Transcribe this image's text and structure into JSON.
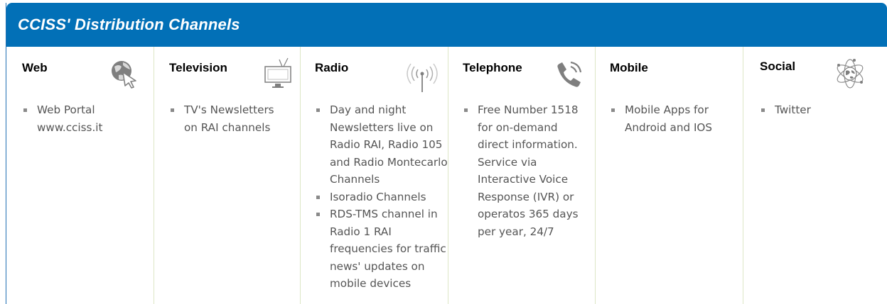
{
  "header": {
    "title": "CCISS' Distribution Channels"
  },
  "colors": {
    "header_bg": "#0270b7",
    "separator": "#dde6c6",
    "text": "#555555"
  },
  "channels": [
    {
      "title": "Web",
      "icon": "globe-cursor-icon",
      "bullets": [
        "Web Portal www.cciss.it"
      ]
    },
    {
      "title": "Television",
      "icon": "tv-icon",
      "bullets": [
        "TV's Newsletters on RAI channels"
      ]
    },
    {
      "title": "Radio",
      "icon": "radio-antenna-icon",
      "bullets": [
        "Day and night Newsletters live on Radio RAI, Radio 105 and Radio Montecarlo Channels",
        "Isoradio Channels",
        "RDS-TMS channel in Radio 1 RAI frequencies for traffic news' updates on mobile devices"
      ]
    },
    {
      "title": "Telephone",
      "icon": "phone-icon",
      "bullets": [
        "Free Number 1518 for on-demand direct information. Service via Interactive Voice Response (IVR) or operatos 365 days per year, 24/7"
      ]
    },
    {
      "title": "Mobile",
      "icon": "",
      "bullets": [
        "Mobile Apps for Android and IOS"
      ]
    },
    {
      "title": "Social",
      "icon": "atom-globe-icon",
      "bullets": [
        "Twitter"
      ]
    }
  ]
}
